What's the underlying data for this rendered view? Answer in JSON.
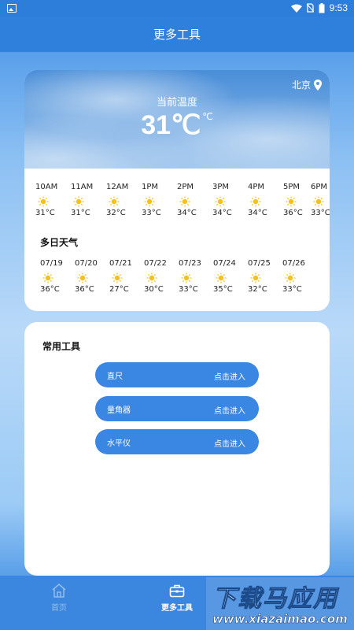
{
  "status_bar": {
    "time": "9:53"
  },
  "header": {
    "title": "更多工具"
  },
  "weather": {
    "location": "北京",
    "current_label": "当前温度",
    "current_temp": "31℃",
    "temp_unit": "℃",
    "hourly": [
      {
        "time": "10AM",
        "icon": "sun-icon",
        "temp": "31°C"
      },
      {
        "time": "11AM",
        "icon": "sun-icon",
        "temp": "31°C"
      },
      {
        "time": "12AM",
        "icon": "sun-icon",
        "temp": "32°C"
      },
      {
        "time": "1PM",
        "icon": "sun-icon",
        "temp": "33°C"
      },
      {
        "time": "2PM",
        "icon": "sun-icon",
        "temp": "34°C"
      },
      {
        "time": "3PM",
        "icon": "sun-icon",
        "temp": "34°C"
      },
      {
        "time": "4PM",
        "icon": "sun-icon",
        "temp": "34°C"
      },
      {
        "time": "5PM",
        "icon": "sun-icon",
        "temp": "36°C"
      },
      {
        "time": "6PM",
        "icon": "sun-icon",
        "temp": "33°C"
      }
    ],
    "multi_day_title": "多日天气",
    "daily": [
      {
        "date": "07/19",
        "icon": "sun-icon",
        "temp": "36°C"
      },
      {
        "date": "07/20",
        "icon": "sun-icon",
        "temp": "36°C"
      },
      {
        "date": "07/21",
        "icon": "sun-icon",
        "temp": "27°C"
      },
      {
        "date": "07/22",
        "icon": "sun-icon",
        "temp": "30°C"
      },
      {
        "date": "07/23",
        "icon": "sun-icon",
        "temp": "33°C"
      },
      {
        "date": "07/24",
        "icon": "sun-icon",
        "temp": "35°C"
      },
      {
        "date": "07/25",
        "icon": "sun-icon",
        "temp": "32°C"
      },
      {
        "date": "07/26",
        "icon": "sun-icon",
        "temp": "33°C"
      }
    ]
  },
  "tools": {
    "title": "常用工具",
    "items": [
      {
        "name": "直尺",
        "action": "点击进入"
      },
      {
        "name": "量角器",
        "action": "点击进入"
      },
      {
        "name": "水平仪",
        "action": "点击进入"
      }
    ]
  },
  "bottom_nav": {
    "items": [
      {
        "label": "首页",
        "icon": "home-icon",
        "active": false
      },
      {
        "label": "更多工具",
        "icon": "toolbox-icon",
        "active": true
      }
    ]
  },
  "watermark": {
    "text": "下载马应用",
    "url": "www.xiazaimao.com"
  },
  "colors": {
    "primary": "#2f80dc",
    "button": "#3a86e3",
    "sun": "#f5c21b"
  }
}
